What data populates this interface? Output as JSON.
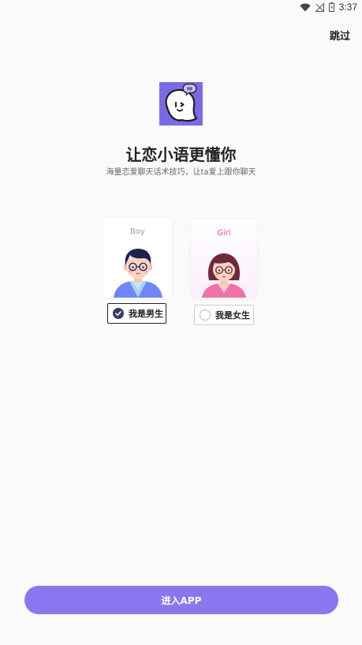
{
  "status_bar": {
    "time": "3:37",
    "icons": [
      "wifi-icon",
      "signal-off-icon",
      "battery-icon"
    ]
  },
  "header": {
    "skip_label": "跳过"
  },
  "app": {
    "logo_icon": "ghost-hi-icon",
    "logo_bubble": "Hi",
    "title": "让恋小语更懂你",
    "subtitle": "海量恋爱聊天话术技巧，让ta爱上跟你聊天"
  },
  "gender": {
    "boy": {
      "card_label": "Boy",
      "choice_label": "我是男生",
      "selected": true
    },
    "girl": {
      "card_label": "Girl",
      "choice_label": "我是女生",
      "selected": false
    }
  },
  "footer": {
    "enter_label": "进入APP"
  },
  "colors": {
    "accent": "#8877ef",
    "logo_bg": "#7b6ae8",
    "girl_label": "#e25a94",
    "check_fill": "#3a3f5c"
  }
}
